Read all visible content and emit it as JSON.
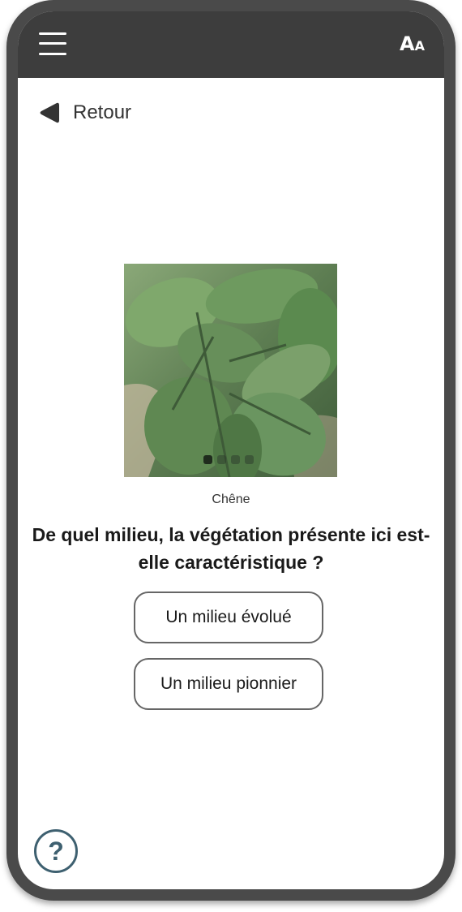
{
  "header": {
    "menu_icon": "hamburger-menu-icon",
    "font_size_big": "A",
    "font_size_small": "A"
  },
  "nav": {
    "back_label": "Retour",
    "back_icon": "back-arrow-icon"
  },
  "media": {
    "image_subject": "oak leaves",
    "caption": "Chêne",
    "carousel_count": 4,
    "carousel_active": 1
  },
  "quiz": {
    "question": "De quel milieu, la végétation présente ici est-elle caractéristique ?",
    "answers": [
      "Un milieu évolué",
      "Un milieu pionnier"
    ]
  },
  "footer": {
    "help_icon": "help-question-icon",
    "help_glyph": "?"
  },
  "colors": {
    "topbar": "#3d3d3d",
    "device_frame": "#4a4a4a",
    "help_accent": "#3e6070",
    "button_border": "#666666"
  }
}
